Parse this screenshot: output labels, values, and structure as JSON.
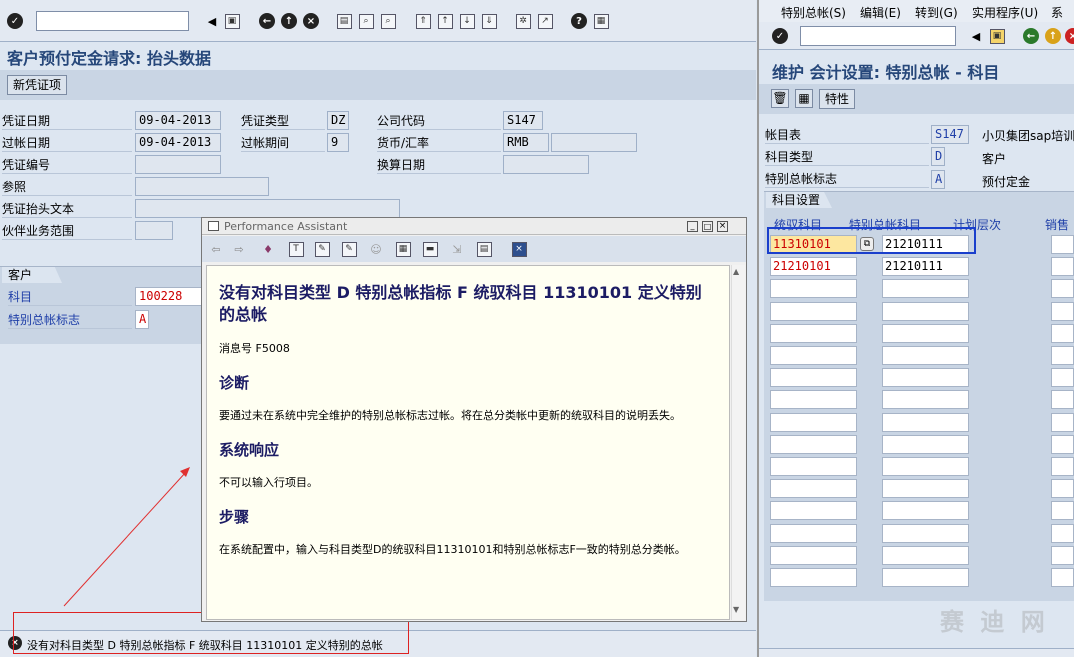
{
  "left": {
    "title": "客户预付定金请求: 抬头数据",
    "new_voucher_btn": "新凭证项",
    "fields": {
      "doc_date_label": "凭证日期",
      "doc_date": "09-04-2013",
      "post_date_label": "过帐日期",
      "post_date": "09-04-2013",
      "doc_no_label": "凭证编号",
      "ref_label": "参照",
      "header_text_label": "凭证抬头文本",
      "partner_label": "伙伴业务范围",
      "doc_type_label": "凭证类型",
      "doc_type": "DZ",
      "period_label": "过帐期间",
      "period": "9",
      "company_label": "公司代码",
      "company": "S147",
      "currency_label": "货币/汇率",
      "currency": "RMB",
      "exchange_date_label": "换算日期"
    },
    "customer_section": "客户",
    "account_label": "科目",
    "account": "100228",
    "sgl_label": "特别总帐标志",
    "sgl": "A"
  },
  "pa": {
    "title": "Performance Assistant",
    "heading": "没有对科目类型 D 特别总帐指标 F 统驭科目 11310101 定义特别的总帐",
    "msg_no": "消息号 F5008",
    "diag_title": "诊断",
    "diag_text": "要通过未在系统中完全维护的特别总帐标志过帐。将在总分类帐中更新的统驭科目的说明丢失。",
    "resp_title": "系统响应",
    "resp_text": "不可以输入行项目。",
    "steps_title": "步骤",
    "steps_text": "在系统配置中，输入与科目类型D的统驭科目11310101和特别总帐标志F一致的特别总分类帐。"
  },
  "status": {
    "message": "没有对科目类型 D 特别总帐指标 F 统驭科目 11310101 定义特别的总帐"
  },
  "right": {
    "menu": [
      "特别总帐(S)",
      "编辑(E)",
      "转到(G)",
      "实用程序(U)",
      "系统"
    ],
    "title": "维护 会计设置: 特别总帐 - 科目",
    "attr_btn": "特性",
    "coa_label": "帐目表",
    "coa": "S147",
    "coa_desc": "小贝集团sap培训",
    "acct_type_label": "科目类型",
    "acct_type": "D",
    "acct_type_desc": "客户",
    "sgl_label": "特别总帐标志",
    "sgl": "A",
    "sgl_desc": "预付定金",
    "section": "科目设置",
    "col_recon": "统驭科目",
    "col_sgl": "特别总帐科目",
    "col_plan": "计划层次",
    "col_sales": "销售",
    "rows": [
      {
        "recon": "11310101",
        "sgl": "21210111"
      },
      {
        "recon": "21210101",
        "sgl": "21210111"
      }
    ]
  },
  "watermark": "赛 迪 网"
}
